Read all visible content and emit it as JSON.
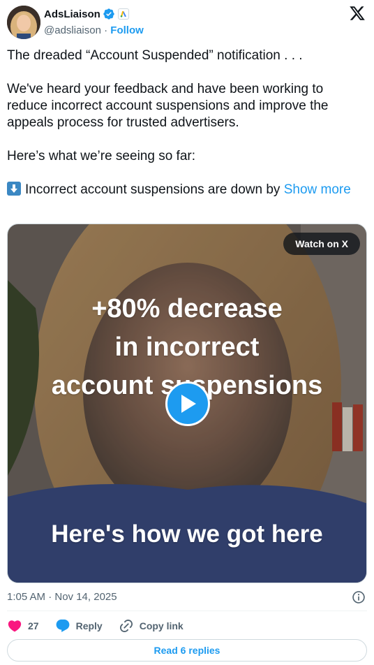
{
  "author": {
    "display_name": "AdsLiaison",
    "handle": "@adsliaison",
    "separator": "·",
    "follow_label": "Follow"
  },
  "tweet": {
    "line1": "The dreaded “Account Suspended” notification . . .",
    "line2": "We've heard your feedback and have been working to reduce incorrect account suspensions and improve the appeals process for trusted advertisers.",
    "line3": "Here’s what we’re seeing so far:",
    "line4": "Incorrect account suspensions are down by",
    "show_more": "Show more"
  },
  "media": {
    "watch_label": "Watch on X",
    "title_line1": "+80% decrease",
    "title_line2": "in incorrect",
    "title_line3": "account suspensions",
    "bottom_text": "Here's how we got here"
  },
  "meta": {
    "timestamp": "1:05 AM · Nov 14, 2025"
  },
  "actions": {
    "like_count": "27",
    "reply_label": "Reply",
    "copy_label": "Copy link"
  },
  "footer": {
    "read_replies": "Read 6 replies"
  },
  "colors": {
    "accent": "#1d9bf0",
    "like": "#f91880",
    "text": "#0f1419",
    "secondary": "#536471"
  },
  "icons": [
    "verified-badge-icon",
    "google-ads-affiliate-icon",
    "x-logo-icon",
    "arrow-down-emoji-icon",
    "play-icon",
    "info-icon",
    "heart-icon",
    "reply-bubble-icon",
    "link-icon"
  ]
}
